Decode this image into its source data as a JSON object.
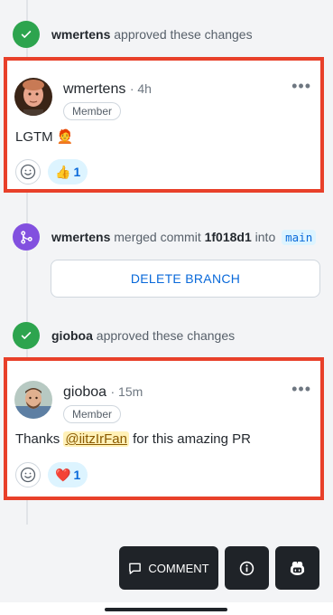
{
  "timeline": [
    {
      "author": "wmertens",
      "action": "approved these changes"
    },
    {
      "author": "wmertens",
      "action": "merged commit",
      "commit": "1f018d1",
      "preposition": "into",
      "branch": "main"
    },
    {
      "author": "gioboa",
      "action": "approved these changes"
    }
  ],
  "comments": [
    {
      "author": "wmertens",
      "time": "· 4h",
      "role": "Member",
      "body": "LGTM 🧑‍🦰",
      "reaction": {
        "emoji": "👍",
        "count": "1"
      }
    },
    {
      "author": "gioboa",
      "time": "· 15m",
      "role": "Member",
      "body_prefix": "Thanks ",
      "mention": "@iitzIrFan",
      "body_suffix": " for this amazing PR",
      "reaction": {
        "emoji": "❤️",
        "count": "1"
      }
    }
  ],
  "delete_branch_label": "DELETE BRANCH",
  "actions": {
    "comment_label": "COMMENT"
  },
  "icons": [
    "check-icon",
    "merge-icon",
    "smiley-icon",
    "info-icon",
    "copilot-icon",
    "comment-icon",
    "more-icon"
  ],
  "colors": {
    "approve": "#2da44e",
    "merge": "#8250df",
    "highlight_border": "#e8402a",
    "link": "#0969da"
  }
}
